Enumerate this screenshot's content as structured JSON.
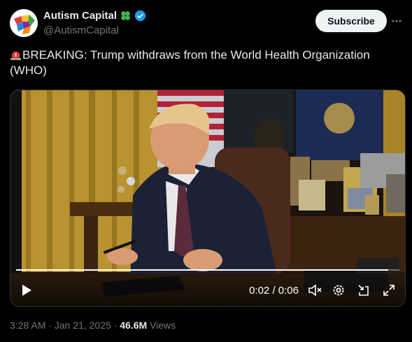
{
  "author": {
    "display_name": "Autism Capital",
    "handle": "@AutismCapital",
    "badge_emoji": "✤",
    "verified": true
  },
  "subscribe_label": "Subscribe",
  "tweet_text": "BREAKING: Trump withdraws from the World Health Organization (WHO)",
  "video": {
    "current_time": "0:02",
    "separator": "/",
    "duration": "0:06",
    "progress_fraction": 0.97
  },
  "footer": {
    "time": "3:28 AM",
    "date": "Jan 21, 2025",
    "views_count": "46.6M",
    "views_label": "Views",
    "separator": "·"
  },
  "colors": {
    "background": "#000000",
    "text_primary": "#e7e9ea",
    "text_secondary": "#71767b",
    "verified_blue": "#1d9bf0",
    "clover_green": "#46b14b"
  },
  "icons": [
    "avatar-puzzle",
    "clover-icon",
    "verified-icon",
    "more-icon",
    "siren-icon",
    "play-icon",
    "mute-icon",
    "settings-icon",
    "minimize-icon",
    "fullscreen-icon"
  ]
}
